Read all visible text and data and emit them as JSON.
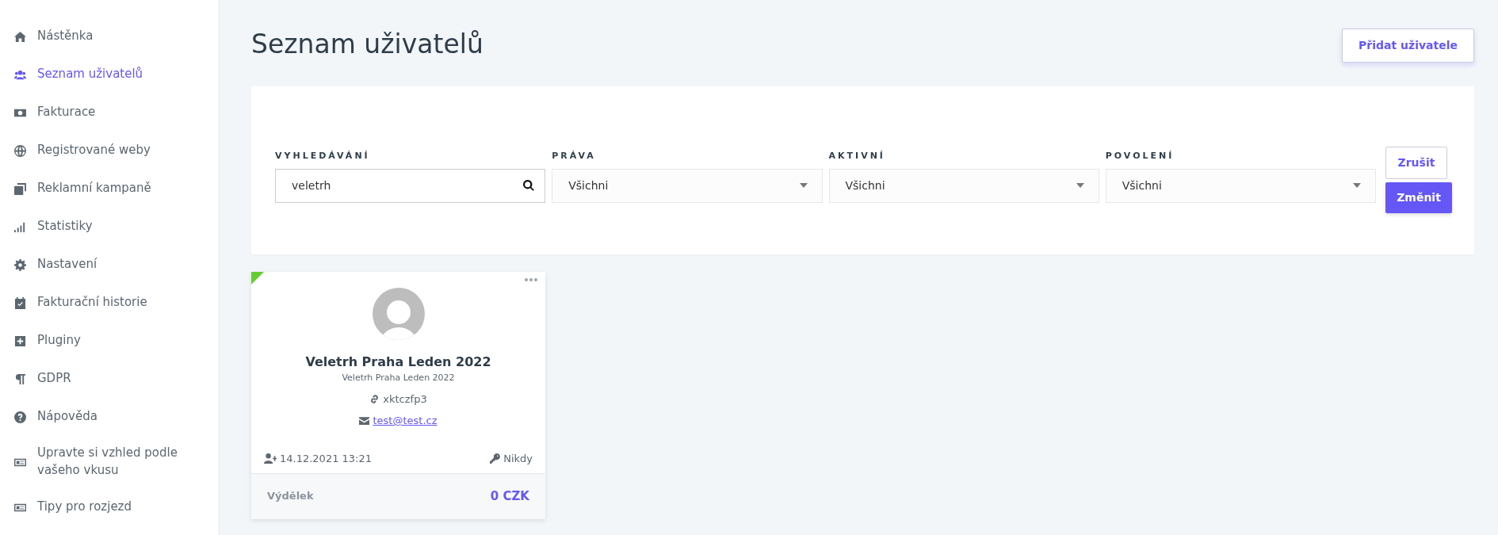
{
  "sidebar": {
    "items": [
      {
        "label": "Nástěnka",
        "selected": false
      },
      {
        "label": "Seznam uživatelů",
        "selected": true
      },
      {
        "label": "Fakturace",
        "selected": false
      },
      {
        "label": "Registrované weby",
        "selected": false
      },
      {
        "label": "Reklamní kampaně",
        "selected": false
      },
      {
        "label": "Statistiky",
        "selected": false
      },
      {
        "label": "Nastavení",
        "selected": false
      },
      {
        "label": "Fakturační historie",
        "selected": false
      },
      {
        "label": "Pluginy",
        "selected": false
      },
      {
        "label": "GDPR",
        "selected": false
      },
      {
        "label": "Nápověda",
        "selected": false
      },
      {
        "label": "Upravte si vzhled podle vašeho vkusu",
        "selected": false
      },
      {
        "label": "Tipy pro rozjezd",
        "selected": false
      }
    ]
  },
  "page": {
    "title": "Seznam uživatelů",
    "add_button": "Přidat uživatele"
  },
  "filters": {
    "fields": [
      {
        "kind": "search",
        "label": "VYHLEDÁVÁNÍ",
        "value": "veletrh"
      },
      {
        "kind": "select",
        "label": "PRÁVA",
        "value": "Všichni"
      },
      {
        "kind": "select",
        "label": "AKTIVNÍ",
        "value": "Všichni"
      },
      {
        "kind": "select",
        "label": "POVOLENÍ",
        "value": "Všichni"
      }
    ],
    "cancel_button": "Zrušit",
    "apply_button": "Změnit"
  },
  "users": [
    {
      "active": true,
      "name": "Veletrh Praha Leden 2022",
      "subtitle": "Veletrh Praha Leden 2022",
      "code": "xktczfp3",
      "email": "test@test.cz",
      "registered": "14.12.2021 13:21",
      "last_login": "Nikdy",
      "earnings_label": "Výdělek",
      "earnings": "0 CZK"
    }
  ]
}
